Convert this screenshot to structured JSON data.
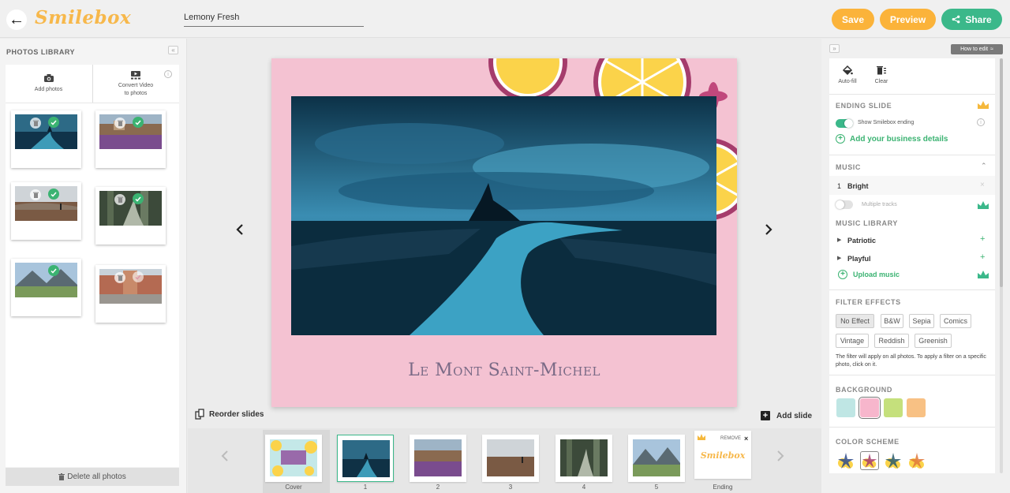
{
  "header": {
    "logo": "Smilebox",
    "project_title": "Lemony Fresh",
    "save_label": "Save",
    "preview_label": "Preview",
    "share_label": "Share"
  },
  "library": {
    "title": "PHOTOS LIBRARY",
    "add_photos": "Add photos",
    "convert_video_1": "Convert Video",
    "convert_video_2": "to photos",
    "delete_all": "Delete all photos",
    "delete_icon": "trash-icon"
  },
  "slide": {
    "caption": "Le Mont Saint-Michel",
    "reorder_label": "Reorder slides",
    "add_slide_label": "Add slide"
  },
  "filmstrip": {
    "items": [
      {
        "label": "Cover"
      },
      {
        "label": "1"
      },
      {
        "label": "2"
      },
      {
        "label": "3"
      },
      {
        "label": "4"
      },
      {
        "label": "5"
      },
      {
        "label": "Ending"
      }
    ],
    "ending_logo": "Smilebox",
    "remove_label": "REMOVE"
  },
  "panel": {
    "how_to_edit": "How to edit",
    "autofill": "Auto-fill",
    "clear": "Clear",
    "ending_slide": {
      "title": "ENDING SLIDE",
      "show_ending": "Show Smilebox ending",
      "add_business": "Add your business details"
    },
    "music": {
      "title": "MUSIC",
      "track_num": "1",
      "track_name": "Bright",
      "multiple_tracks": "Multiple tracks"
    },
    "music_library": {
      "title": "MUSIC LIBRARY",
      "items": [
        "Patriotic",
        "Playful"
      ],
      "upload": "Upload music"
    },
    "filters": {
      "title": "FILTER EFFECTS",
      "options": [
        "No Effect",
        "B&W",
        "Sepia",
        "Comics",
        "Vintage",
        "Reddish",
        "Greenish"
      ],
      "selected": "No Effect",
      "note": "The filter will apply on all photos. To apply a filter on a specific photo, click on it."
    },
    "background": {
      "title": "BACKGROUND",
      "swatches": [
        "#bfe6e4",
        "#f7b6cc",
        "#c5e07c",
        "#f8c184"
      ],
      "selected_index": 1
    },
    "color_scheme": {
      "title": "COLOR SCHEME",
      "selected_index": 1
    }
  },
  "colors": {
    "accent_orange": "#fbb33a",
    "accent_green": "#3bb88a",
    "slide_pink": "#f4c2d2"
  }
}
